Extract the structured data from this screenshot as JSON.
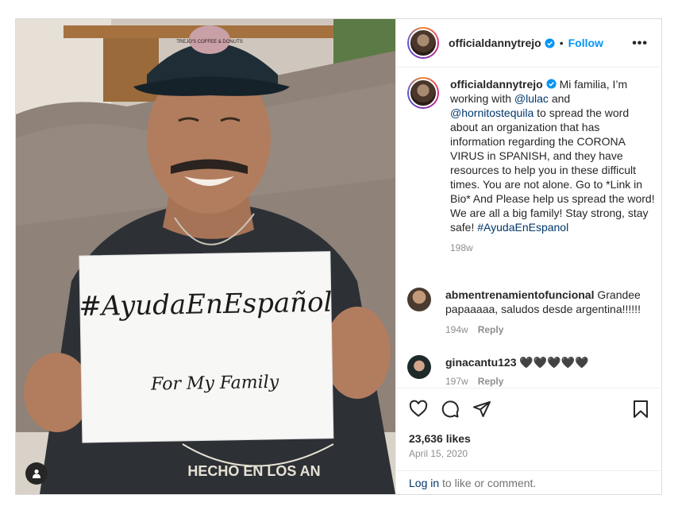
{
  "post": {
    "author": "officialdannytrejo",
    "separator": "•",
    "follow_label": "Follow",
    "more_label": "•••",
    "caption": {
      "parts": [
        {
          "type": "text",
          "text": "Mi familia, I’m working with "
        },
        {
          "type": "mention",
          "text": "@lulac"
        },
        {
          "type": "text",
          "text": " and "
        },
        {
          "type": "mention",
          "text": "@hornitostequila"
        },
        {
          "type": "text",
          "text": " to spread the word about an organization that has information regarding the CORONA VIRUS in SPANISH, and they have resources to help you in these difficult times. You are not alone. Go to *Link in Bio* And Please help us spread the word! We are all a big family! Stay strong, stay safe! "
        },
        {
          "type": "hashtag",
          "text": "#AyudaEnEspanol"
        }
      ],
      "time": "198w"
    },
    "comments": [
      {
        "user": "abmentrenamientofuncional",
        "text": "Grandee papaaaaa, saludos desde argentina!!!!!!",
        "time": "194w",
        "reply": "Reply"
      },
      {
        "user": "ginacantu123",
        "text": "🖤🖤🖤🖤🖤",
        "time": "197w",
        "reply": "Reply"
      }
    ],
    "likes": "23,636 likes",
    "date": "April 15, 2020",
    "login_link": "Log in",
    "login_text": " to like or comment."
  },
  "photo": {
    "cap_text": "TREJO'S COFFEE & DONUTS",
    "sign_line1": "#AyudaEnEspañol",
    "sign_line2": "For My Family",
    "shirt_text": "HECHO EN LOS AN"
  },
  "icons": {
    "like": "heart-icon",
    "comment": "comment-icon",
    "share": "paper-plane-icon",
    "save": "bookmark-icon",
    "verified": "verified-badge-icon",
    "tag": "user-tag-icon",
    "more": "more-options-icon"
  },
  "colors": {
    "accent": "#0095f6",
    "link": "#00376b",
    "muted": "#8e8e8e",
    "border": "#dbdbdb"
  }
}
